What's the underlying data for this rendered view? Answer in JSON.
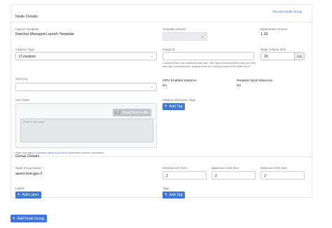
{
  "node_details": {
    "title": "Node Details",
    "remove_link": "Remove Node Group",
    "launch_template": {
      "label": "Launch Template",
      "value": "Rancher Managed Launch Template"
    },
    "template_version": {
      "label": "Template Version"
    },
    "kubernetes_version": {
      "label": "Kubernetes Version",
      "value": "1.18"
    },
    "instance_type": {
      "label": "Instance Type",
      "value": "t3.medium"
    },
    "image_id": {
      "label": "Image ID",
      "help_prefix": "Custom AMIs is an advanced use case. We highly recommended that you read and fully understand the requirements for creating custom EKS AMIs",
      "help_link": "here"
    },
    "node_volume_size": {
      "label": "Node Volume Size",
      "value": "20",
      "unit": "GB"
    },
    "ssh_key": {
      "label": "SSH Key"
    },
    "gpu_enabled": {
      "label": "GPU Enabled Instance",
      "value": "No"
    },
    "spot_instances": {
      "label": "Request Spot Instances",
      "value": "No"
    },
    "user_data": {
      "label": "User Data",
      "read_file_button": "Read from a file",
      "placeholder": "Paste in the script",
      "help_prefix": "Pass user data to",
      "help_link": "Amazon using cloud-init",
      "help_suffix": "to automate common operations."
    },
    "instance_resource_tags": {
      "label": "Instance Resource Tags",
      "add_button": "Add Tag"
    }
  },
  "group_details": {
    "title": "Group Details",
    "node_group_name": {
      "label": "Node Group Name",
      "required_mark": "*",
      "value": "aaron-test-gpu-2"
    },
    "desired_asg_size": {
      "label": "Desired ASG Size",
      "value": "2"
    },
    "maximum_asg_size": {
      "label": "Maximum ASG Size",
      "value": "2"
    },
    "minimum_asg_size": {
      "label": "Minimum ASG Size",
      "value": "2"
    },
    "labels": {
      "label": "Labels",
      "add_button": "Add Label"
    },
    "tags": {
      "label": "Tags",
      "add_button": "Add Tag"
    }
  },
  "add_node_group_button": "Add Node Group",
  "colors": {
    "accent": "#3d78d8",
    "link": "#3d6fd6"
  },
  "icons": {
    "dropdown": "chevron-down-icon",
    "add": "plus-icon",
    "upload": "upload-icon"
  }
}
